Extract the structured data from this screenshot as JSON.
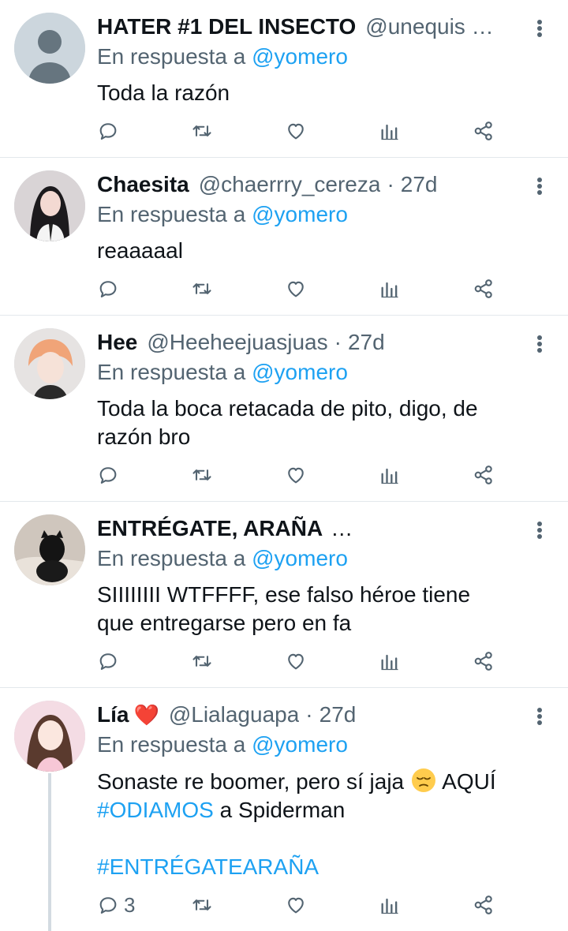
{
  "tweets": [
    {
      "name": "HATER #1 DEL INSECTO",
      "handle": "@unequis …",
      "age": "",
      "reply_prefix": "En respuesta a",
      "reply_to": "@yomero",
      "lines": [
        "Toda la razón"
      ],
      "avatar": "default-avatar"
    },
    {
      "name": "Chaesita",
      "handle": "@chaerrry_cereza",
      "age": "27d",
      "reply_prefix": "En respuesta a",
      "reply_to": "@yomero",
      "lines": [
        "reaaaaal"
      ],
      "avatar": "photo-girl-dark-hair"
    },
    {
      "name": "Hee",
      "handle": "@Heeheejuasjuas",
      "age": "27d",
      "reply_prefix": "En respuesta a",
      "reply_to": "@yomero",
      "lines": [
        "Toda la boca retacada de pito, digo, de",
        "razón bro"
      ],
      "avatar": "photo-orange-hair"
    },
    {
      "name": "ENTRÉGATE, ARAÑA",
      "ellipsis": "…",
      "handle": "",
      "age": "",
      "reply_prefix": "En respuesta a",
      "reply_to": "@yomero",
      "lines": [
        "SIIIIIIII WTFFFF, ese falso héroe tiene",
        "que entregarse pero en fa"
      ],
      "avatar": "photo-black-cat"
    },
    {
      "name": "Lía",
      "name_emoji": "❤️",
      "handle": "@Lialaguapa",
      "age": "27d",
      "reply_prefix": "En respuesta a",
      "reply_to": "@yomero",
      "line1_a": "Sonaste re boomer, pero sí jaja",
      "line1_b": "AQUÍ",
      "line2_tag": "#ODIAMOS",
      "line2_rest": "a Spiderman",
      "line3_tag": "#ENTRÉGATEARAÑA",
      "reply_count": "3",
      "avatar": "photo-girl-pink"
    }
  ],
  "icons": {
    "reply": "reply-icon",
    "retweet": "retweet-icon",
    "like": "heart-icon",
    "analytics": "analytics-icon",
    "share": "share-icon",
    "menu": "more-vertical-icon"
  },
  "colors": {
    "link": "#1da1f2",
    "secondary": "#536471",
    "divider": "#e3e8ec",
    "heart": "#e0245e"
  }
}
